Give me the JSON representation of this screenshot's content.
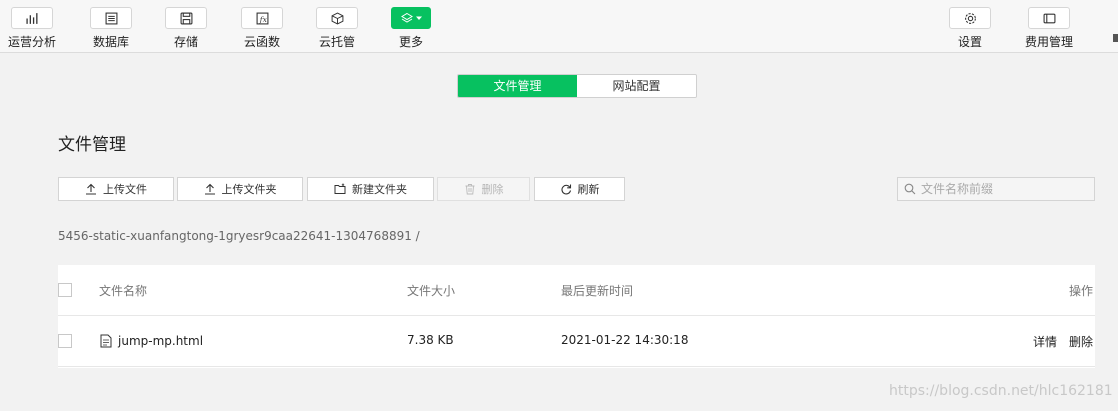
{
  "toolbar": {
    "items": [
      {
        "label": "运营分析",
        "icon": "bar-chart-icon"
      },
      {
        "label": "数据库",
        "icon": "database-icon"
      },
      {
        "label": "存储",
        "icon": "storage-icon"
      },
      {
        "label": "云函数",
        "icon": "function-icon"
      },
      {
        "label": "云托管",
        "icon": "cube-icon"
      },
      {
        "label": "更多",
        "icon": "layers-icon"
      }
    ],
    "right_items": [
      {
        "label": "设置",
        "icon": "gear-icon"
      },
      {
        "label": "费用管理",
        "icon": "card-icon"
      }
    ]
  },
  "tabs": [
    {
      "label": "文件管理",
      "active": true
    },
    {
      "label": "网站配置",
      "active": false
    }
  ],
  "page": {
    "title": "文件管理"
  },
  "actions": {
    "upload_file": "上传文件",
    "upload_folder": "上传文件夹",
    "new_folder": "新建文件夹",
    "delete": "删除",
    "refresh": "刷新"
  },
  "search": {
    "placeholder": "文件名称前缀"
  },
  "path": "5456-static-xuanfangtong-1gryesr9caa22641-1304768891  /",
  "table": {
    "headers": {
      "name": "文件名称",
      "size": "文件大小",
      "updated": "最后更新时间",
      "ops": "操作"
    },
    "rows": [
      {
        "name": "jump-mp.html",
        "size": "7.38 KB",
        "updated": "2021-01-22 14:30:18",
        "detail": "详情",
        "delete": "删除"
      }
    ]
  },
  "watermark": "https://blog.csdn.net/hlc162181",
  "colors": {
    "accent": "#07c160",
    "link": "#1b8cd8"
  }
}
